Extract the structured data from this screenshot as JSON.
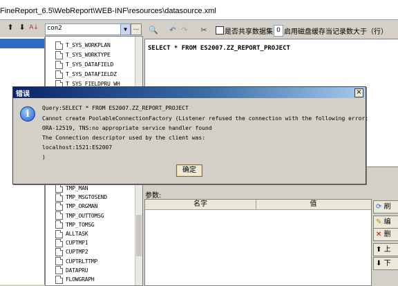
{
  "window": {
    "title": "FineReport_6.5\\WebReport\\WEB-INF\\resources\\datasource.xml"
  },
  "left_toolbar": {
    "icons": [
      "arrow-up-icon",
      "arrow-down-icon",
      "sort-az-icon"
    ]
  },
  "connection": {
    "selected": "con2",
    "browse_label": "..."
  },
  "tables_top": [
    "T_SYS_WORKPLAN",
    "T_SYS_WORKTYPE",
    "T_SYS_DATAFIELD",
    "T_SYS_DATAFIELDZ",
    "T_SYS_FIELDPRU_WH"
  ],
  "tables_bottom": [
    "TMP_MAN",
    "TMP_MSGTOSEND",
    "TMP_ORGMAN",
    "TMP_OUTTOMSG",
    "TMP_TOMSG",
    "ALLTASK",
    "CUPTMP1",
    "CUPTMP2",
    "CUPTRLTTMP",
    "DATAPRU",
    "FLOWGRAPH"
  ],
  "editor_toolbar": {
    "share_label": "是否共享数据集",
    "cache_value": "0",
    "cache_label": "启用磁盘缓存当记录数大于（行）"
  },
  "editor": {
    "sql": "SELECT * FROM ES2007.ZZ_REPORT_PROJECT"
  },
  "params": {
    "label": "参数:",
    "col_name": "名字",
    "col_value": "值"
  },
  "side_buttons": [
    "刷",
    "编",
    "删",
    "上",
    "下"
  ],
  "dialog": {
    "title": "错误",
    "lines": [
      "Query:SELECT * FROM ES2007.ZZ_REPORT_PROJECT",
      "Cannot create PoolableConnectionFactory (Listener refused the connection with the following error:",
      "ORA-12519, TNS:no appropriate service handler found",
      "The Connection descriptor used by the client was:",
      "localhost:1521:ES2007",
      ")"
    ],
    "ok_label": "确定"
  }
}
